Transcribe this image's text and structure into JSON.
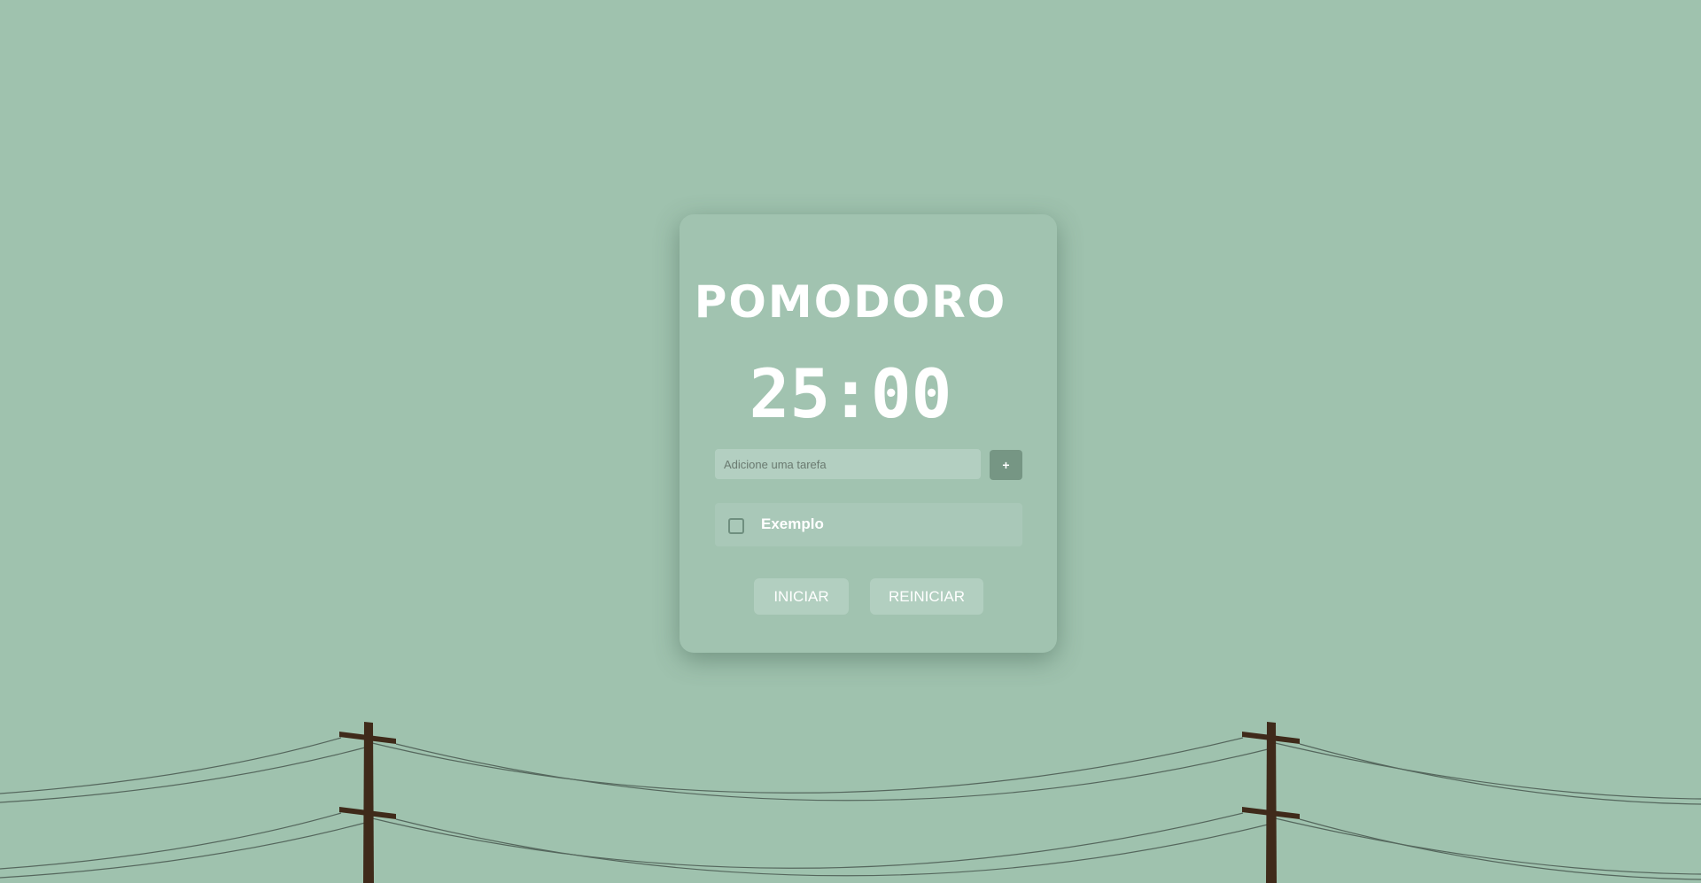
{
  "app": {
    "title": "POMODORO",
    "timer": "25:00",
    "task_input": {
      "placeholder": "Adicione uma tarefa",
      "value": ""
    },
    "add_button": "+",
    "tasks": [
      {
        "label": "Exemplo",
        "done": false
      }
    ],
    "start_button": "INICIAR",
    "reset_button": "REINICIAR"
  },
  "colors": {
    "background": "#9fc2ae",
    "card": "#a1c3b0",
    "accent": "#769684",
    "pole": "#3f2a1a"
  }
}
